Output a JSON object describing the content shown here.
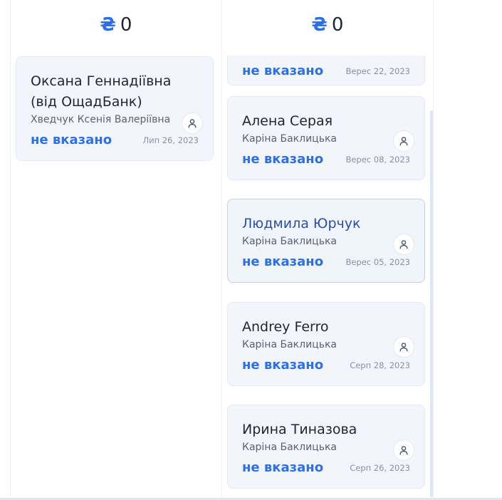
{
  "columns": [
    {
      "currency": "₴",
      "total": "0",
      "cards": [
        {
          "title": "Оксана Геннадіївна (від ОщадБанк)",
          "assignee": "Хведчук Ксенія Валеріївна",
          "status": "не вказано",
          "date": "Лип 26, 2023",
          "icon": "user-icon"
        }
      ]
    },
    {
      "currency": "₴",
      "total": "0",
      "cards": [
        {
          "title": "",
          "assignee": "",
          "status": "не вказано",
          "date": "Верес 22, 2023",
          "icon": "user-icon"
        },
        {
          "title": "Алена Серая",
          "assignee": "Каріна Баклицька",
          "status": "не вказано",
          "date": "Верес 08, 2023",
          "icon": "user-icon"
        },
        {
          "title": "Людмила Юрчук",
          "assignee": "Каріна Баклицька",
          "status": "не вказано",
          "date": "Верес 05, 2023",
          "icon": "user-icon",
          "selected": true
        },
        {
          "title": "Andrey Ferro",
          "assignee": "Каріна Баклицька",
          "status": "не вказано",
          "date": "Серп 28, 2023",
          "icon": "user-icon"
        },
        {
          "title": "Ирина Тиназова",
          "assignee": "Каріна Баклицька",
          "status": "не вказано",
          "date": "Серп 26, 2023",
          "icon": "user-icon"
        }
      ]
    }
  ],
  "colors": {
    "accent": "#2f6fe4",
    "card_bg": "#f2f6fc",
    "selected_title": "#2b4fa6"
  }
}
